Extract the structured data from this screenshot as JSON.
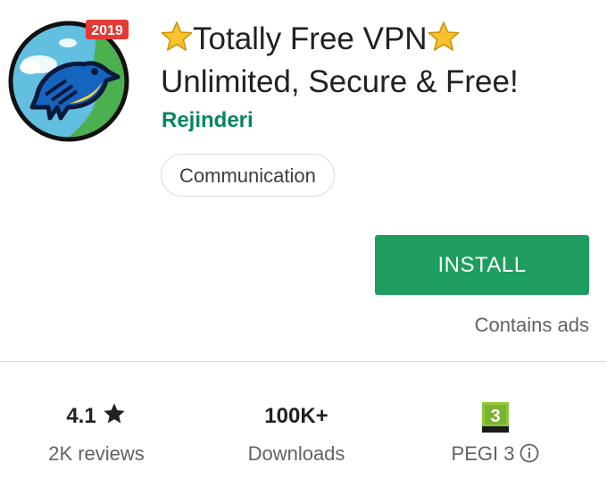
{
  "app": {
    "title_line1": "Totally Free VPN",
    "title_line2": "Unlimited, Secure & Free!",
    "developer": "Rejinderi",
    "category": "Communication",
    "icon": "bird-logo-icon",
    "icon_badge": "2019",
    "title_decoration_icon": "star-glyph-icon"
  },
  "actions": {
    "install_label": "INSTALL",
    "contains_ads": "Contains ads"
  },
  "stats": {
    "rating": {
      "value": "4.1",
      "icon": "star-icon",
      "label": "2K reviews"
    },
    "downloads": {
      "value": "100K+",
      "label": "Downloads"
    },
    "content_rating": {
      "badge": "3",
      "label": "PEGI 3",
      "icon": "info-icon"
    }
  },
  "colors": {
    "install_button": "#1d9d5e",
    "developer_text": "#01875f",
    "badge_red": "#e53935",
    "pegi_green": "#8ec63f"
  }
}
